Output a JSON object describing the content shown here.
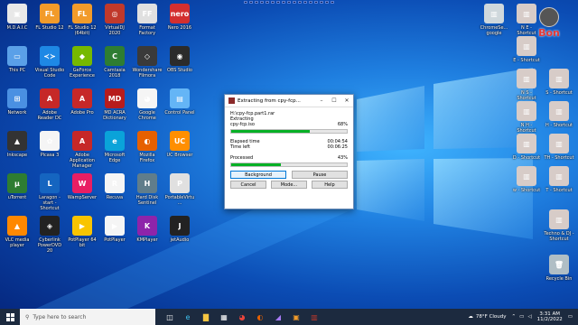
{
  "desktop_icons_left": [
    {
      "label": "M.D.A.I.C",
      "color": "#e8e8e8",
      "glyph": "▣"
    },
    {
      "label": "FL Studio 12",
      "color": "#f29b2a",
      "glyph": "FL"
    },
    {
      "label": "FL Studio 12 (64bit)",
      "color": "#f29b2a",
      "glyph": "FL"
    },
    {
      "label": "VirtualDJ 2020",
      "color": "#c0392b",
      "glyph": "◎"
    },
    {
      "label": "Format Factory",
      "color": "#e0e0e0",
      "glyph": "FF"
    },
    {
      "label": "Nero 2016",
      "color": "#d32f2f",
      "glyph": "nero"
    },
    {
      "label": "This PC",
      "color": "#5aa0e8",
      "glyph": "▭"
    },
    {
      "label": "Visual Studio Code",
      "color": "#1e88e5",
      "glyph": "≺≻"
    },
    {
      "label": "GeForce Experience",
      "color": "#76b900",
      "glyph": "◆"
    },
    {
      "label": "Camtasia 2018",
      "color": "#2e7d32",
      "glyph": "C"
    },
    {
      "label": "Wondershare Filmora",
      "color": "#3a3a3a",
      "glyph": "◇"
    },
    {
      "label": "OBS Studio",
      "color": "#2b2b2b",
      "glyph": "◉"
    },
    {
      "label": "Network",
      "color": "#4a90e2",
      "glyph": "⊞"
    },
    {
      "label": "Adobe Reader DC",
      "color": "#c62828",
      "glyph": "A"
    },
    {
      "label": "Adobe Pro",
      "color": "#c62828",
      "glyph": "A"
    },
    {
      "label": "MD ACRA Dictionary",
      "color": "#b71c1c",
      "glyph": "MD"
    },
    {
      "label": "Google Chrome",
      "color": "#f5f5f5",
      "glyph": "◕"
    },
    {
      "label": "Control Panel",
      "color": "#64b5f6",
      "glyph": "▤"
    },
    {
      "label": "Inkscape",
      "color": "#333333",
      "glyph": "▲"
    },
    {
      "label": "Picasa 3",
      "color": "#f5f5f5",
      "glyph": "✿"
    },
    {
      "label": "Adobe Application Manager",
      "color": "#c62828",
      "glyph": "A"
    },
    {
      "label": "Microsoft Edge",
      "color": "#0aa3d9",
      "glyph": "e"
    },
    {
      "label": "Mozilla Firefox",
      "color": "#e66000",
      "glyph": "◐"
    },
    {
      "label": "UC Browser",
      "color": "#ff8f00",
      "glyph": "UC"
    },
    {
      "label": "uTorrent",
      "color": "#2e7d32",
      "glyph": "μ"
    },
    {
      "label": "Laragon - start - Shortcut",
      "color": "#1565c0",
      "glyph": "L"
    },
    {
      "label": "WampServer",
      "color": "#e91e63",
      "glyph": "W"
    },
    {
      "label": "Recuva",
      "color": "#f5f5f5",
      "glyph": "R"
    },
    {
      "label": "Hard Disk Sentinel",
      "color": "#607d8b",
      "glyph": "H"
    },
    {
      "label": "PortableVirtu...",
      "color": "#e0e0e0",
      "glyph": "P"
    },
    {
      "label": "VLC media player",
      "color": "#ff8800",
      "glyph": "▲"
    },
    {
      "label": "Cyberlink PowerDVD 20",
      "color": "#222222",
      "glyph": "◈"
    },
    {
      "label": "PotPlayer 64 bit",
      "color": "#f9c400",
      "glyph": "▶"
    },
    {
      "label": "PotPlayer",
      "color": "#f5f5f5",
      "glyph": "▶"
    },
    {
      "label": "KMPlayer",
      "color": "#8e24aa",
      "glyph": "K"
    },
    {
      "label": "jetAudio",
      "color": "#222222",
      "glyph": "J"
    }
  ],
  "desktop_icons_right": [
    {
      "label": "ChromeSe... google",
      "color": "#cfd8dc",
      "glyph": "▥"
    },
    {
      "label": "N E - Shortcut",
      "color": "#d7ccc8",
      "glyph": "▥"
    },
    {
      "label": "E - Shortcut",
      "color": "#d7ccc8",
      "glyph": "▥"
    },
    {
      "label": "Shortcut",
      "color": "#d7ccc8",
      "glyph": "▥"
    },
    {
      "label": "N S - Shortcut",
      "color": "#d7ccc8",
      "glyph": "▥"
    },
    {
      "label": "S - Shortcut",
      "color": "#d7ccc8",
      "glyph": "▥"
    },
    {
      "label": "N H - Shortcut",
      "color": "#d7ccc8",
      "glyph": "▥"
    },
    {
      "label": "H - Shortcut",
      "color": "#d7ccc8",
      "glyph": "▥"
    },
    {
      "label": "D - Shortcut",
      "color": "#d7ccc8",
      "glyph": "▥"
    },
    {
      "label": "TH - Shortcut",
      "color": "#d7ccc8",
      "glyph": "▥"
    },
    {
      "label": "w - Shortcut",
      "color": "#d7ccc8",
      "glyph": "▥"
    },
    {
      "label": "T - Shortcut",
      "color": "#d7ccc8",
      "glyph": "▥"
    },
    {
      "label": "Techno & DJ - Shortcut",
      "color": "#d7ccc8",
      "glyph": "▥"
    },
    {
      "label": "Recycle Bin",
      "color": "#b0bec5",
      "glyph": "🗑"
    }
  ],
  "watermark_text": "Bon",
  "dialog": {
    "title": "Extracting from cpy-fcp...",
    "archive": "H:\\cpy-fcp.part1.rar",
    "action": "Extracting",
    "file": "cpy-fcp.iso",
    "file_percent_label": "68%",
    "file_progress": 0.68,
    "elapsed_label": "Elapsed time",
    "elapsed_value": "00:04:54",
    "left_label": "Time left",
    "left_value": "00:06:25",
    "processed_label": "Processed",
    "processed_percent_label": "43%",
    "processed_progress": 0.43,
    "buttons": {
      "background": "Background",
      "pause": "Pause",
      "cancel": "Cancel",
      "mode": "Mode...",
      "help": "Help"
    }
  },
  "taskbar": {
    "search_placeholder": "Type here to search",
    "weather": "78°F  Cloudy",
    "time": "3:31 AM",
    "date": "11/2/2022"
  }
}
